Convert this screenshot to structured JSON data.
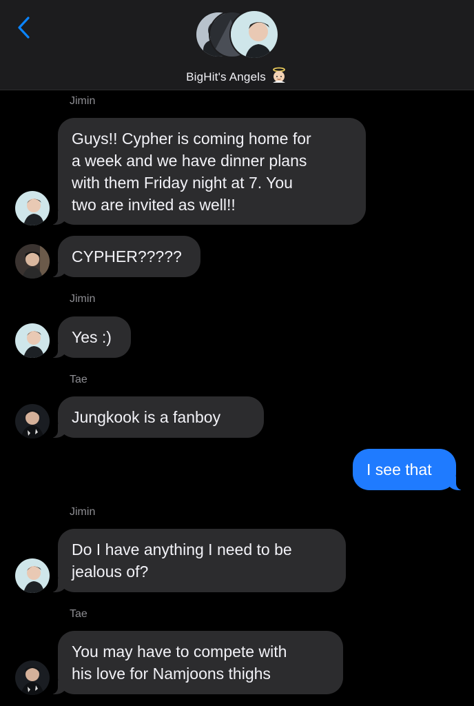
{
  "header": {
    "title": "BigHit's Angels",
    "title_emoji": "baby-angel-emoji",
    "back_icon": "chevron-left-icon",
    "colors": {
      "back": "#0a84ff",
      "header_bg": "#1c1c1e"
    }
  },
  "messages": [
    {
      "sender": "Jimin",
      "text": "Guys!! Cypher is coming home for\na week and we have dinner plans\nwith them Friday night at 7. You\ntwo are invited as well!!",
      "avatar": "jimin-avatar"
    },
    {
      "sender": "",
      "text": "CYPHER?????",
      "avatar": "jungkook-avatar"
    },
    {
      "sender": "Jimin",
      "text": "Yes :)",
      "avatar": "jimin-avatar"
    },
    {
      "sender": "Tae",
      "text": "Jungkook is a fanboy",
      "avatar": "tae-avatar"
    },
    {
      "sender": "",
      "text": "I see that",
      "outgoing": true
    },
    {
      "sender": "Jimin",
      "text": "Do I have anything I need to be\njealous of?",
      "avatar": "jimin-avatar"
    },
    {
      "sender": "Tae",
      "text": "You may have to compete with\nhis love for Namjoons thighs",
      "avatar": "tae-avatar"
    }
  ],
  "colors": {
    "incoming_bubble": "#2c2c2e",
    "outgoing_bubble": "#1f7bff",
    "sender_label": "#8e8e93"
  }
}
